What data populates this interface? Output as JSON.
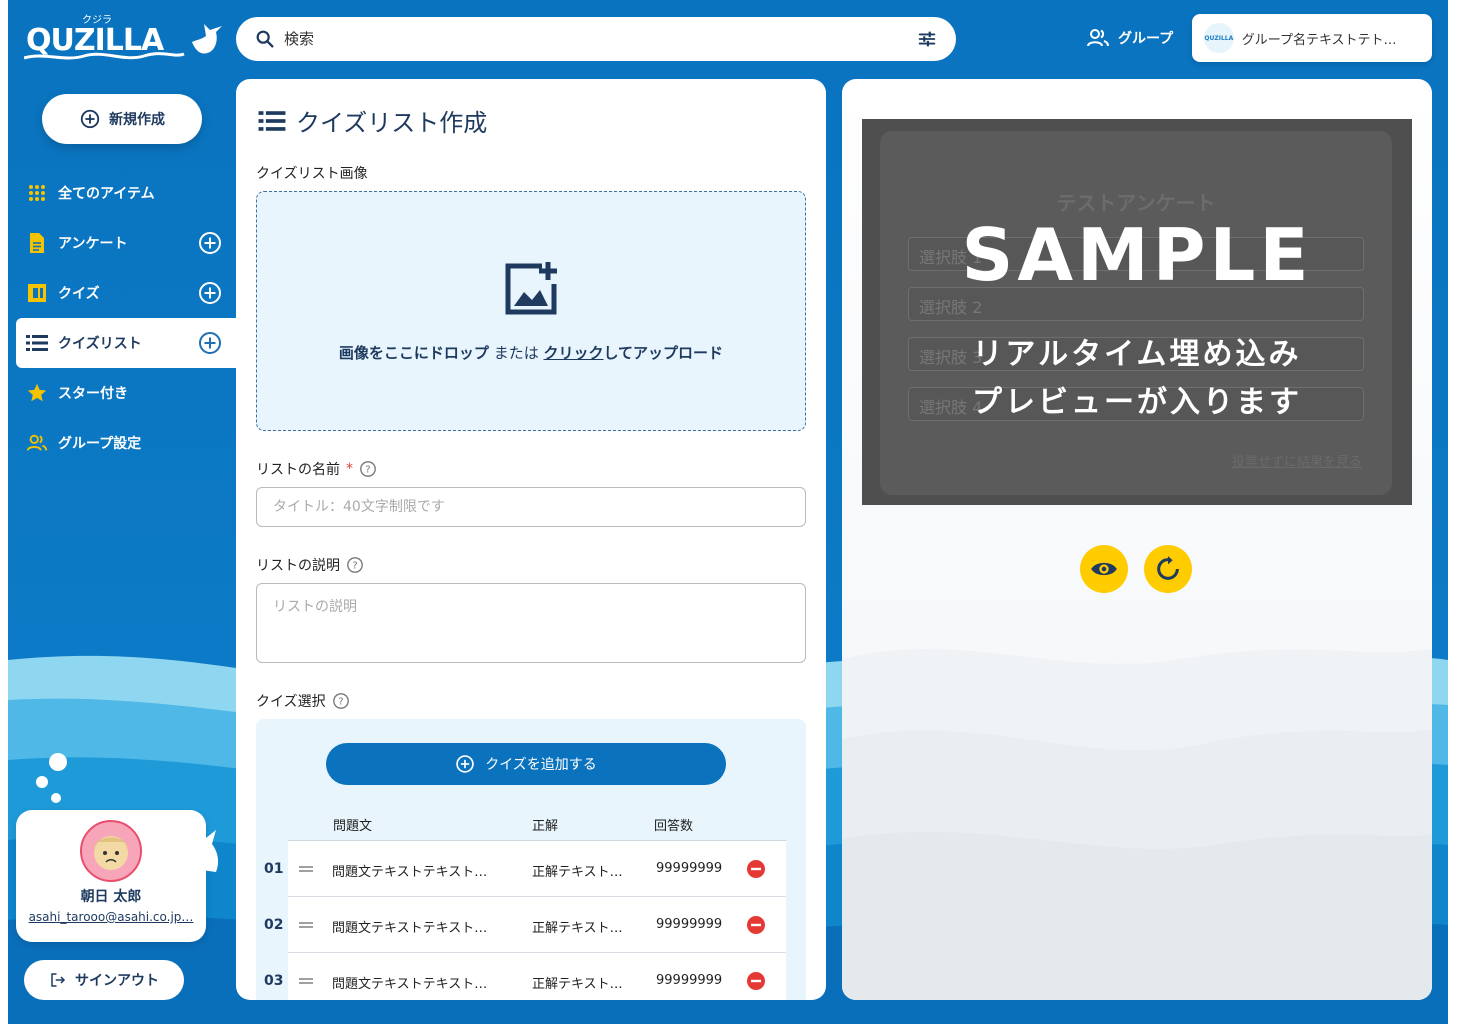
{
  "header": {
    "logo_text": "QUZILLA",
    "logo_ruby": "クジラ",
    "search": {
      "placeholder": "検索",
      "icon": "search-icon",
      "filter_icon": "tune-icon"
    },
    "group_link": {
      "label": "グループ",
      "icon": "group-icon"
    },
    "group_select": {
      "name": "グループ名テキストテト…",
      "avatar_text": "QUZILLA"
    }
  },
  "sidebar": {
    "new_button": "新規作成",
    "items": [
      {
        "label": "全てのアイテム",
        "icon": "apps-grid-icon",
        "has_add": false,
        "active": false
      },
      {
        "label": "アンケート",
        "icon": "document-icon",
        "has_add": true,
        "active": false
      },
      {
        "label": "クイズ",
        "icon": "quiz-icon",
        "has_add": true,
        "active": false
      },
      {
        "label": "クイズリスト",
        "icon": "list-icon",
        "has_add": true,
        "active": true
      },
      {
        "label": "スター付き",
        "icon": "star-icon",
        "has_add": false,
        "active": false
      },
      {
        "label": "グループ設定",
        "icon": "group-settings-icon",
        "has_add": false,
        "active": false
      }
    ],
    "user": {
      "name": "朝日 太郎",
      "email": "asahi_tarooo@asahi.co.jp…"
    },
    "signout": "サインアウト"
  },
  "form": {
    "title": "クイズリスト作成",
    "image_label": "クイズリスト画像",
    "dropzone": {
      "part1": "画像をここにドロップ",
      "part2": " または ",
      "part3": "クリック",
      "part4": "してアップロード"
    },
    "name_label": "リストの名前",
    "name_required": "*",
    "name_placeholder": "タイトル：40文字制限です",
    "desc_label": "リストの説明",
    "desc_placeholder": "リストの説明",
    "quiz_label": "クイズ選択",
    "add_quiz": "クイズを追加する",
    "columns": {
      "question": "問題文",
      "answer": "正解",
      "count": "回答数"
    },
    "rows": [
      {
        "num": "01",
        "question": "問題文テキストテキスト…",
        "answer": "正解テキスト…",
        "count": "99999999"
      },
      {
        "num": "02",
        "question": "問題文テキストテキスト…",
        "answer": "正解テキスト…",
        "count": "99999999"
      },
      {
        "num": "03",
        "question": "問題文テキストテキスト…",
        "answer": "正解テキスト…",
        "count": "99999999"
      }
    ]
  },
  "preview": {
    "survey_title": "テストアンケート",
    "options": [
      "選択肢 1",
      "選択肢 2",
      "選択肢 3",
      "選択肢 4"
    ],
    "skip_link": "投票せずに結果を見る",
    "sample_text": "SAMPLE",
    "sample_line1": "リアルタイム埋め込み",
    "sample_line2": "プレビューが入ります",
    "buttons": [
      "eye-icon",
      "refresh-icon"
    ],
    "accent": "#ffcc00"
  },
  "colors": {
    "primary": "#0b73bd",
    "navy": "#1e3a5f",
    "accent": "#f5c400",
    "danger": "#e53935"
  }
}
